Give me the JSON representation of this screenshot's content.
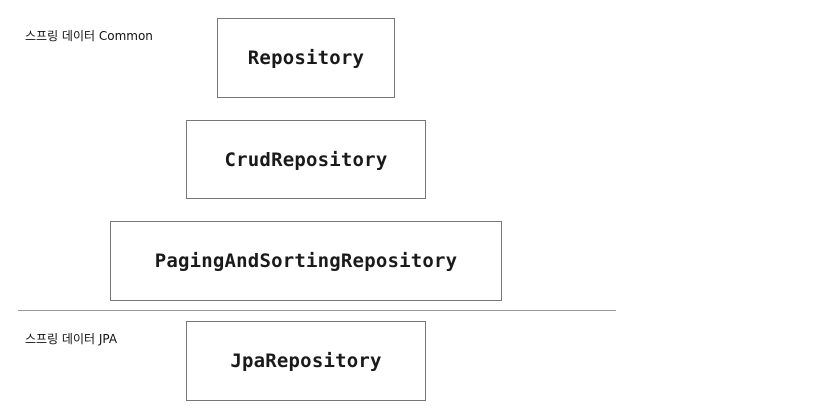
{
  "sections": {
    "common_label": "스프링 데이터  Common",
    "jpa_label": "스프링 데이터  JPA"
  },
  "boxes": {
    "repository": "Repository",
    "crud_repository": "CrudRepository",
    "paging_and_sorting_repository": "PagingAndSortingRepository",
    "jpa_repository": "JpaRepository"
  },
  "colors": {
    "box_border": "#777777",
    "divider": "#9a9a9a",
    "text": "#1a1a1a"
  }
}
